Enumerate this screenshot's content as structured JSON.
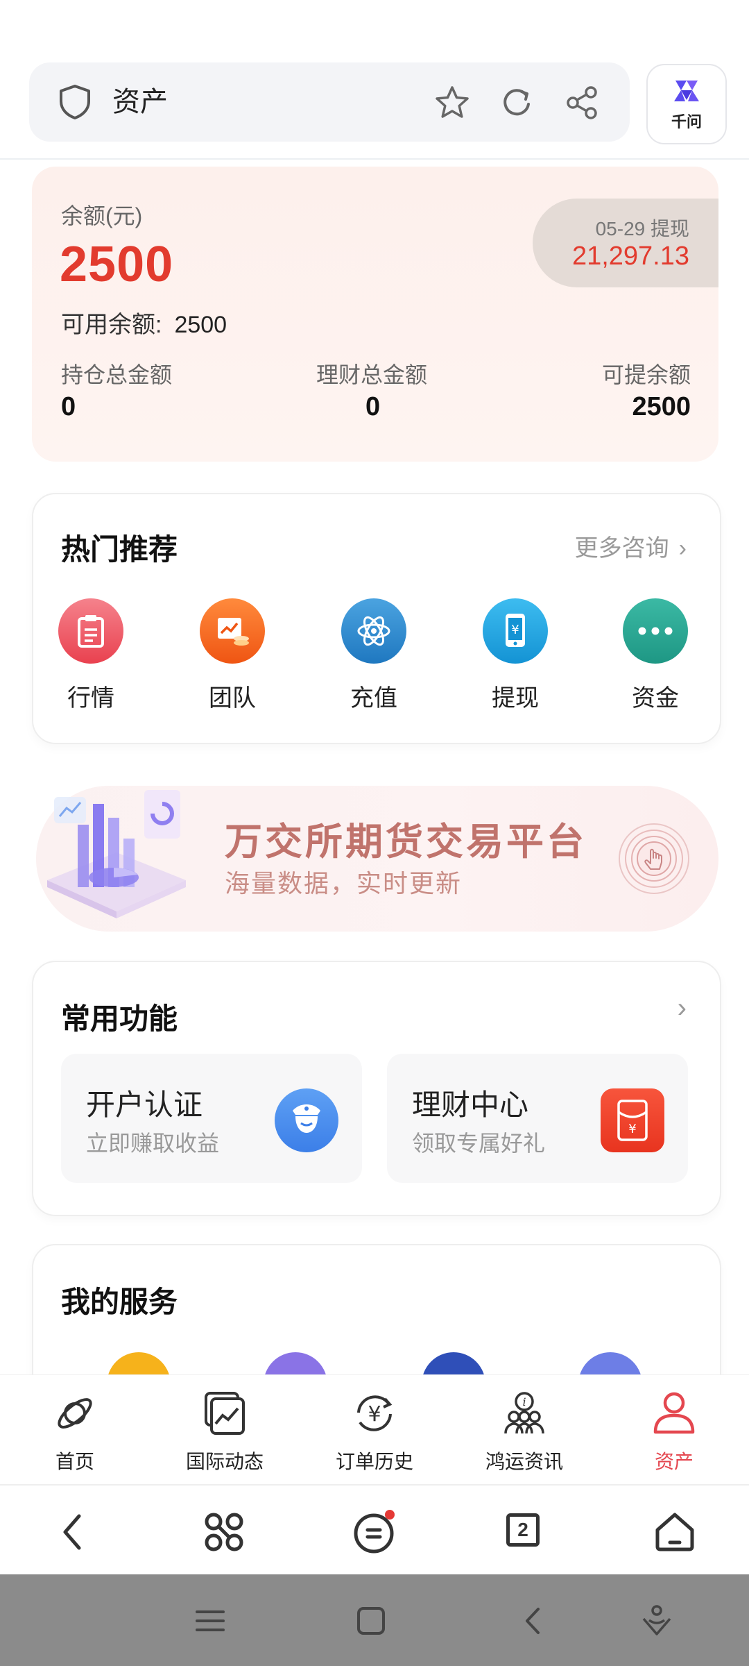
{
  "browser": {
    "title": "资产",
    "assistant_label": "千问"
  },
  "balance": {
    "label": "余额(元)",
    "value": "2500",
    "available_label": "可用余额:",
    "available_value": "2500",
    "withdraw_date": "05-29 提现",
    "withdraw_amount": "21,297.13",
    "stats": [
      {
        "label": "持仓总金额",
        "value": "0"
      },
      {
        "label": "理财总金额",
        "value": "0"
      },
      {
        "label": "可提余额",
        "value": "2500"
      }
    ]
  },
  "hot": {
    "title": "热门推荐",
    "more_label": "更多咨询",
    "items": [
      {
        "label": "行情",
        "icon": "clipboard-icon",
        "color": "#ee4f5c"
      },
      {
        "label": "团队",
        "icon": "chart-coins-icon",
        "color": "#f2641e"
      },
      {
        "label": "充值",
        "icon": "atom-icon",
        "color": "#2f86c9"
      },
      {
        "label": "提现",
        "icon": "phone-yen-icon",
        "color": "#25a6df"
      },
      {
        "label": "资金",
        "icon": "more-dots-icon",
        "color": "#2ba695"
      }
    ]
  },
  "banner": {
    "title": "万交所期货交易平台",
    "subtitle": "海量数据，实时更新"
  },
  "functions": {
    "title": "常用功能",
    "items": [
      {
        "title": "开户认证",
        "subtitle": "立即赚取收益",
        "icon": "officer-icon",
        "color": "#4a8ef0"
      },
      {
        "title": "理财中心",
        "subtitle": "领取专属好礼",
        "icon": "red-envelope-icon",
        "color": "#f0452f"
      }
    ]
  },
  "services": {
    "title": "我的服务"
  },
  "tabs": [
    {
      "label": "首页",
      "icon": "orbit-icon"
    },
    {
      "label": "国际动态",
      "icon": "chart-card-icon"
    },
    {
      "label": "订单历史",
      "icon": "yen-refresh-icon"
    },
    {
      "label": "鸿运资讯",
      "icon": "info-people-icon"
    },
    {
      "label": "资产",
      "icon": "user-icon",
      "active": true
    }
  ],
  "browser_nav": {
    "tab_count": "2"
  },
  "colors": {
    "accent_red": "#e23b2e",
    "active_tab": "#e4474f"
  }
}
